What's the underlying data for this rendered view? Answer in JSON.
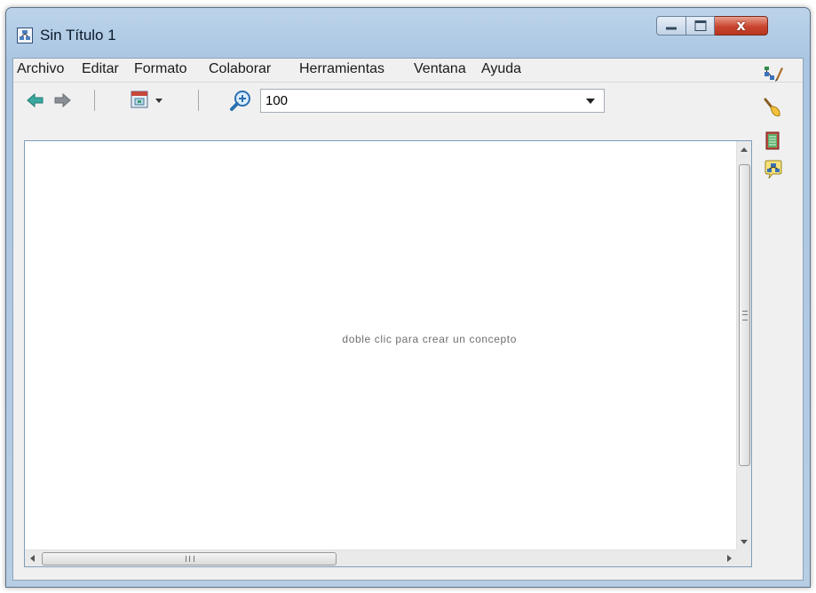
{
  "window": {
    "title": "Sin Título 1",
    "close_glyph": "x"
  },
  "menu": {
    "items": [
      "Archivo",
      "Editar",
      "Formato",
      "Colaborar",
      "Herramientas",
      "Ventana",
      "Ayuda"
    ]
  },
  "toolbar": {
    "zoom_value": "100",
    "icons": [
      "back-arrow-icon",
      "forward-arrow-icon",
      "view-mode-icon",
      "zoom-icon"
    ]
  },
  "canvas": {
    "hint": "doble clic para crear un concepto"
  },
  "side_tools": {
    "icons": [
      "styles-palette-icon",
      "brush-icon",
      "notes-icon",
      "collaboration-icon"
    ]
  },
  "colors": {
    "title_bar": "#aac6e2",
    "close_button": "#c9452e",
    "nav_arrow_active": "#3aa9a0",
    "nav_arrow_inactive": "#8a8f96"
  }
}
